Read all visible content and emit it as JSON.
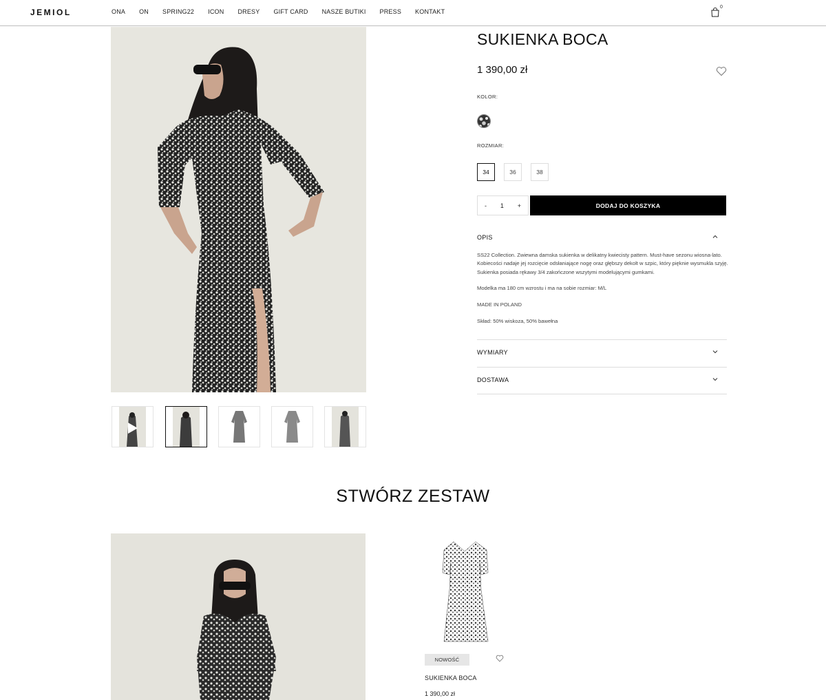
{
  "header": {
    "logo": "JEMIOL",
    "nav": [
      "ONA",
      "ON",
      "SPRING22",
      "ICON",
      "DRESY",
      "GIFT CARD",
      "NASZE BUTIKI",
      "PRESS",
      "KONTAKT"
    ],
    "cart_count": "0"
  },
  "product": {
    "title": "SUKIENKA BOCA",
    "price": "1 390,00 zł",
    "color_label": "KOLOR:",
    "size_label": "ROZMIAR:",
    "sizes": [
      "34",
      "36",
      "38"
    ],
    "selected_size": "34",
    "quantity": "1",
    "qty_minus": "-",
    "qty_plus": "+",
    "add_to_cart": "DODAJ DO KOSZYKA"
  },
  "accordion": {
    "opis": {
      "title": "OPIS",
      "p1": "SS22 Collection. Zwiewna damska sukienka w delikatny kwiecisty pattern. Must-have sezonu wiosna-lato. Kobiecości nadaje jej rozcięcie odsłaniające nogę oraz głębszy dekolt w szpic, który pięknie wysmukla szyję. Sukienka posiada rękawy 3/4 zakończone wszytymi modelującymi gumkami.",
      "p2": "Modelka ma 180 cm wzrostu i ma na sobie rozmiar: M/L",
      "p3": "MADE IN POLAND",
      "p4": "Skład: 50% wiskoza, 50% bawełna"
    },
    "wymiary": {
      "title": "WYMIARY"
    },
    "dostawa": {
      "title": "DOSTAWA"
    }
  },
  "set": {
    "title": "STWÓRZ ZESTAW",
    "card": {
      "badge": "NOWOŚĆ",
      "name": "SUKIENKA BOCA",
      "price": "1 390,00 zł"
    }
  },
  "colors": {
    "accent": "#000000",
    "divider": "#dddddd",
    "photo_bg": "#e7e6df"
  }
}
